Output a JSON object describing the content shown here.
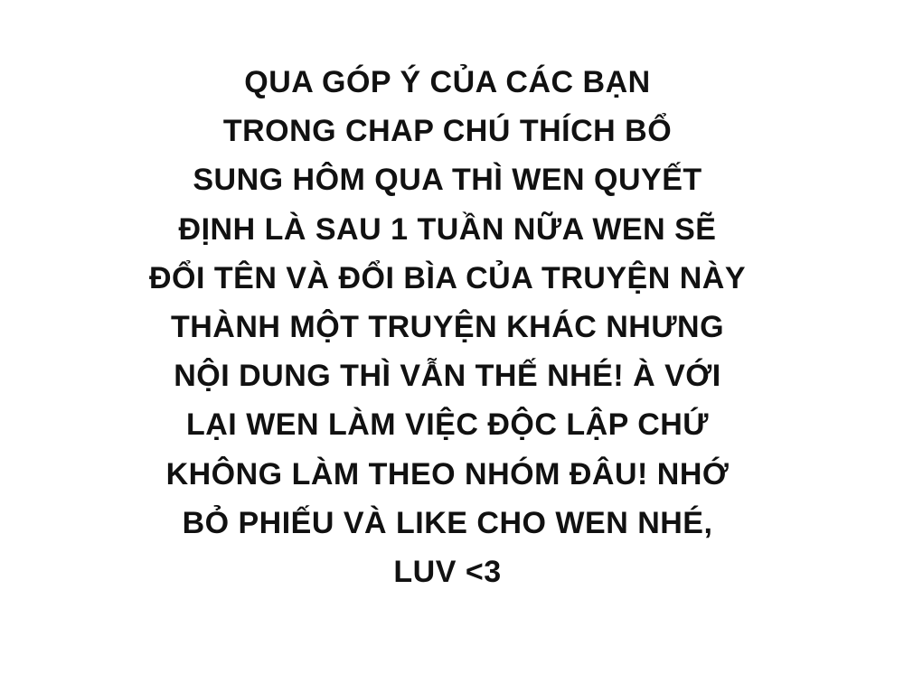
{
  "message": {
    "lines": [
      "QUA GÓP Ý CỦA CÁC BẠN",
      "TRONG CHAP CHÚ THÍCH BỔ",
      "SUNG HÔM QUA THÌ WEN QUYẾT",
      "ĐỊNH LÀ SAU 1 TUẦN NỮA WEN SẼ",
      "ĐỔI TÊN VÀ ĐỔI BÌA CỦA TRUYỆN NÀY",
      "THÀNH MỘT TRUYỆN KHÁC NHƯNG",
      "NỘI DUNG THÌ VẪN THẾ NHÉ! À VỚI",
      "LẠI WEN LÀM VIỆC ĐỘC LẬP CHỨ",
      "KHÔNG LÀM THEO NHÓM ĐÂU! NHỚ",
      "BỎ PHIẾU VÀ LIKE CHO WEN NHÉ,",
      "LUV <3"
    ]
  }
}
